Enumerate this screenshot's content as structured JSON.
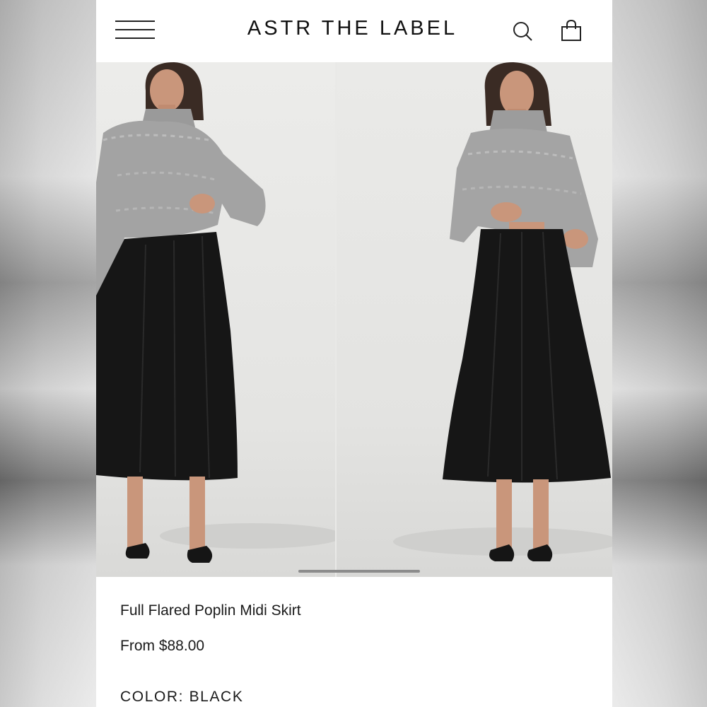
{
  "header": {
    "brand": "ASTR THE LABEL",
    "menu_icon": "hamburger-menu-icon",
    "search_icon": "search-icon",
    "bag_icon": "shopping-bag-icon"
  },
  "product": {
    "title": "Full Flared Poplin Midi Skirt",
    "price": "From $88.00",
    "color_label": "COLOR:",
    "color_value": "BLACK"
  },
  "gallery": {
    "images": [
      "model-photo-front",
      "model-photo-lifting-sweater"
    ],
    "colors": {
      "sweater": "#9d9d9d",
      "skirt": "#151515",
      "backdrop": "#e8e8e6"
    }
  }
}
